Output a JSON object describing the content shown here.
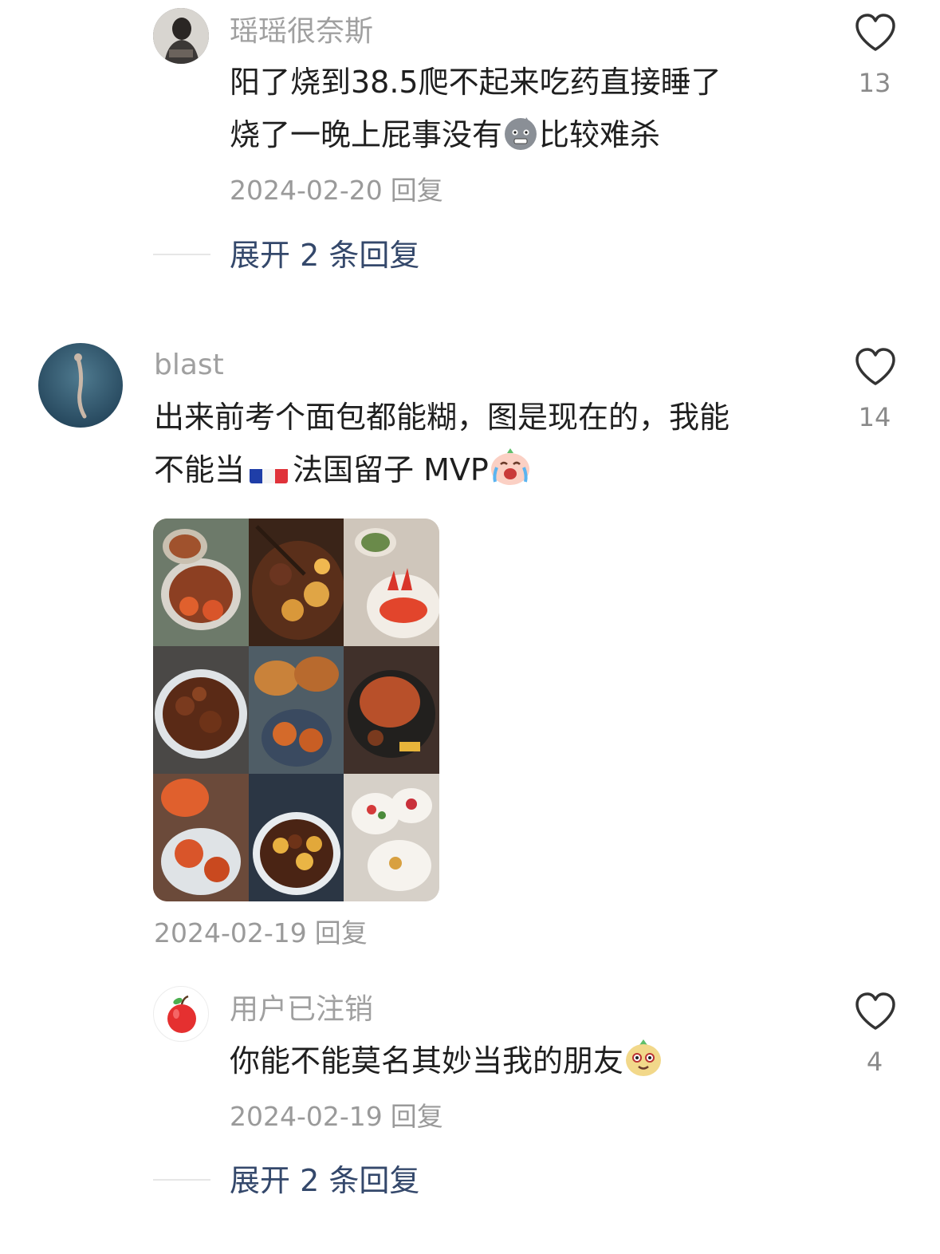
{
  "comments": [
    {
      "username": "瑶瑶很奈斯",
      "text_line1": "阳了烧到38.5爬不起来吃药直接睡了",
      "text_line2_a": "烧了一晚上屁事没有",
      "text_line2_b": "比较难杀",
      "date": "2024-02-20",
      "reply_label": "回复",
      "likes": "13",
      "expand_label": "展开 2 条回复"
    },
    {
      "username": "blast",
      "text_line1": "出来前考个面包都能糊，图是现在的，我能",
      "text_line2_a": "不能当",
      "text_line2_b": "法国留子 MVP",
      "date": "2024-02-19",
      "reply_label": "回复",
      "likes": "14"
    },
    {
      "username": "用户已注销",
      "text_line1": "你能不能莫名其妙当我的朋友",
      "date": "2024-02-19",
      "reply_label": "回复",
      "likes": "4",
      "expand_label": "展开 2 条回复"
    }
  ],
  "colors": {
    "username": "#a0a0a0",
    "expand": "#34486b",
    "meta": "#9a9a9a"
  },
  "icons": [
    "heart-outline-icon",
    "france-flag-emoji",
    "grimace-emoji",
    "crying-laugh-emoji",
    "smirk-emoji"
  ]
}
